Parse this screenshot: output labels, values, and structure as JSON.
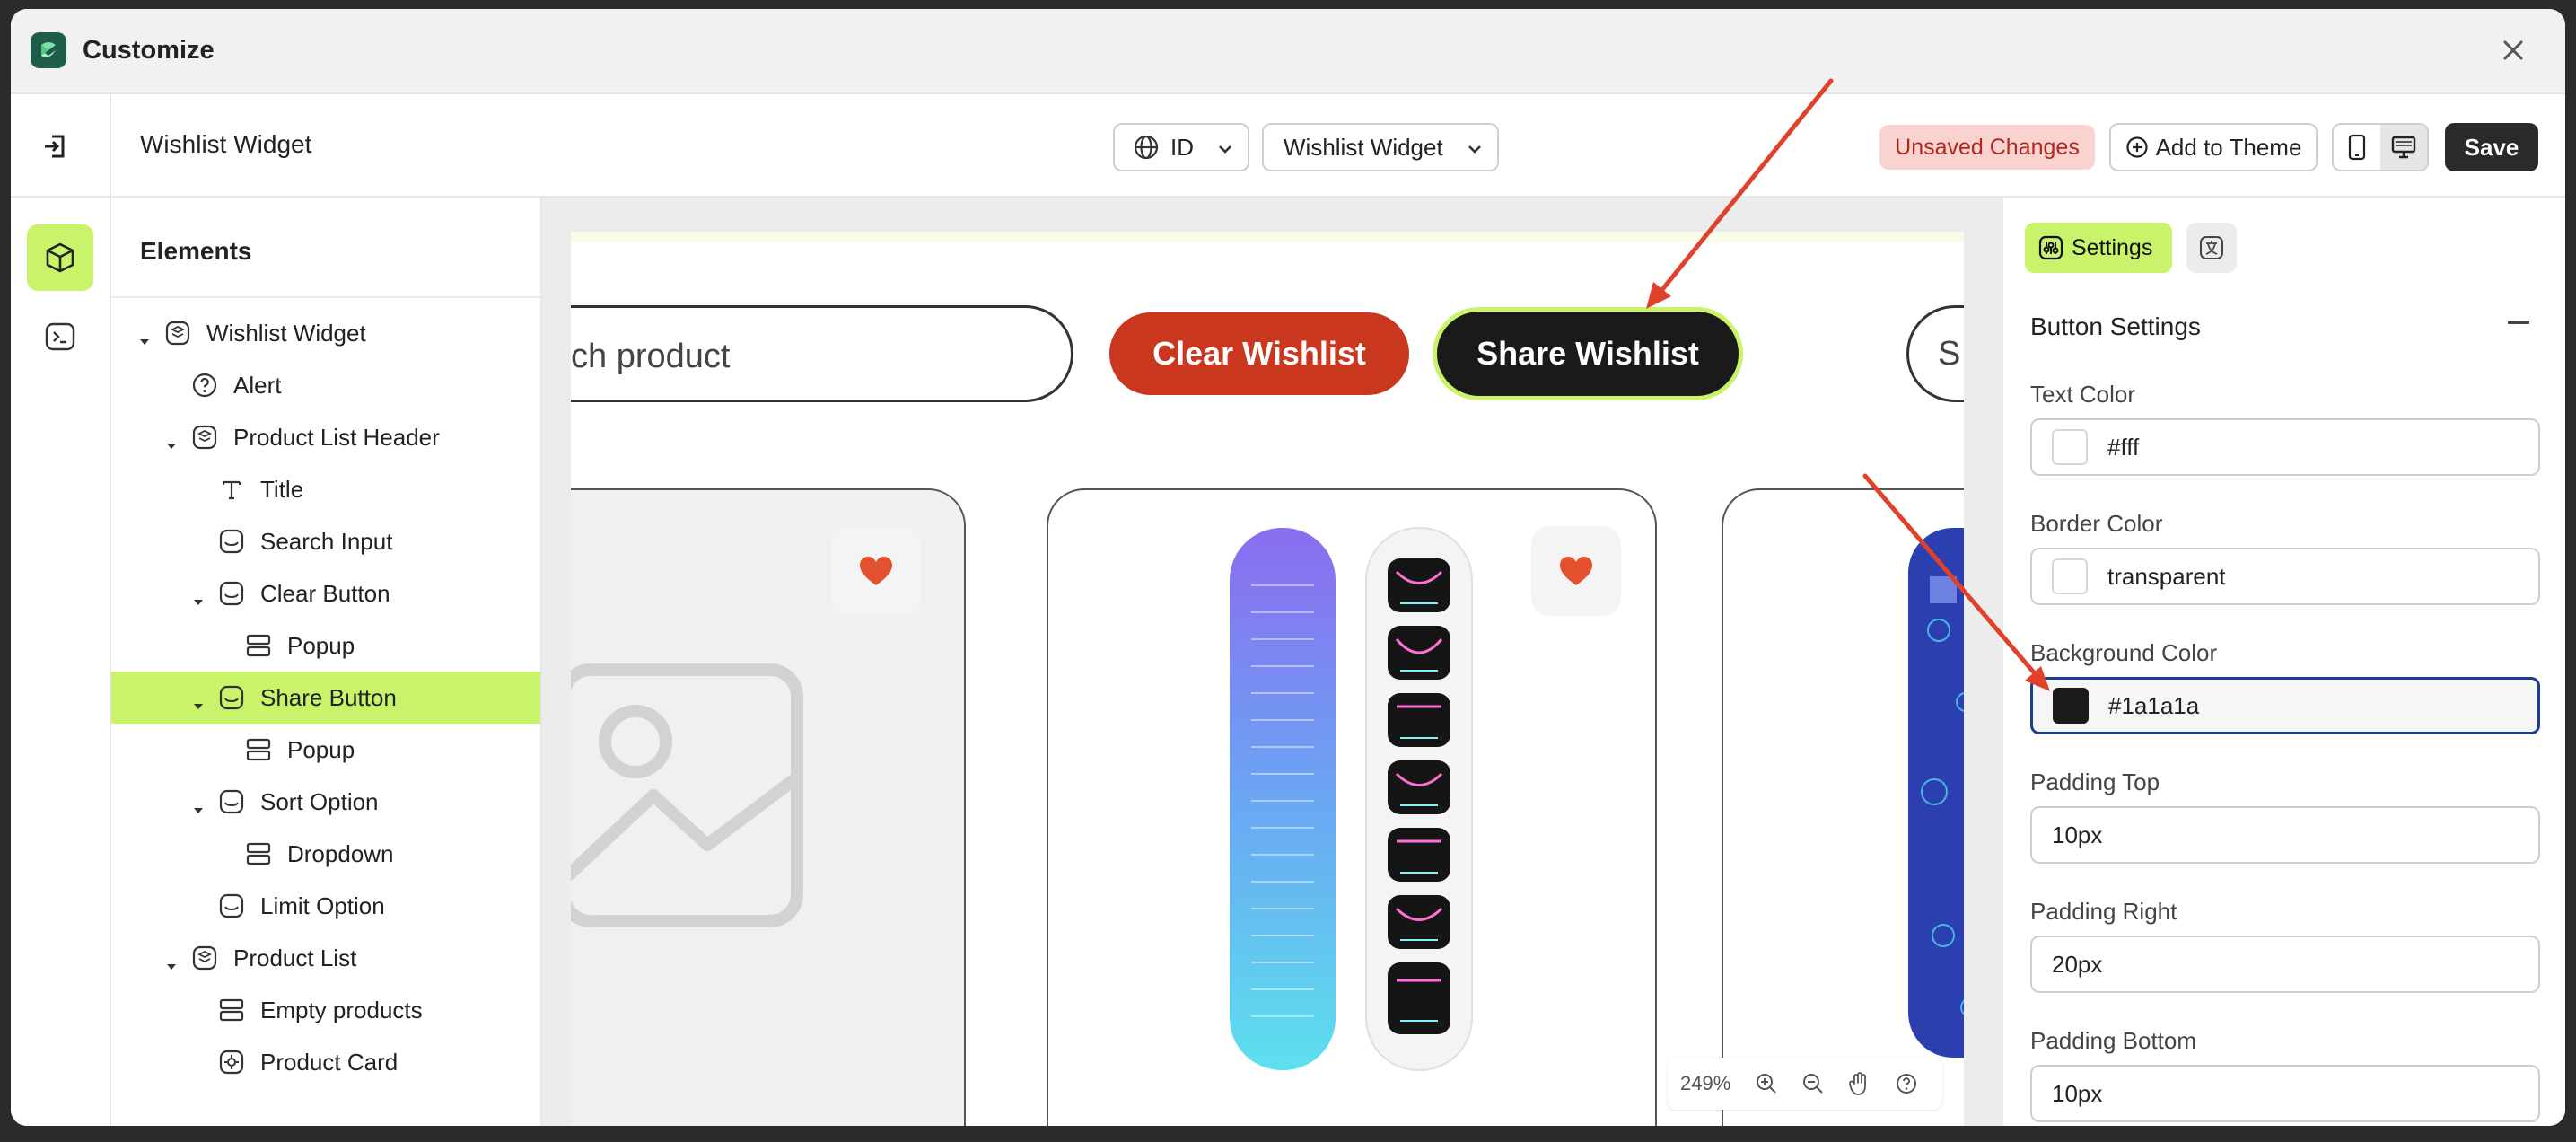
{
  "window": {
    "title": "Customize"
  },
  "toolbar": {
    "page_name": "Wishlist Widget",
    "language": "ID",
    "widget_select": "Wishlist Widget",
    "unsaved_label": "Unsaved Changes",
    "add_theme_label": "Add to Theme",
    "save_label": "Save"
  },
  "elements_panel": {
    "title": "Elements",
    "tree": [
      {
        "label": "Wishlist Widget",
        "depth": 0,
        "caret": true,
        "icon": "widget-icon"
      },
      {
        "label": "Alert",
        "depth": 1,
        "caret": false,
        "icon": "help-circle-icon"
      },
      {
        "label": "Product List Header",
        "depth": 1,
        "caret": true,
        "icon": "widget-icon"
      },
      {
        "label": "Title",
        "depth": 2,
        "caret": false,
        "icon": "text-icon"
      },
      {
        "label": "Search Input",
        "depth": 2,
        "caret": false,
        "icon": "block-icon"
      },
      {
        "label": "Clear Button",
        "depth": 2,
        "caret": true,
        "icon": "block-icon"
      },
      {
        "label": "Popup",
        "depth": 3,
        "caret": false,
        "icon": "layout-rows-icon"
      },
      {
        "label": "Share Button",
        "depth": 2,
        "caret": true,
        "icon": "block-icon",
        "selected": true
      },
      {
        "label": "Popup",
        "depth": 3,
        "caret": false,
        "icon": "layout-rows-icon"
      },
      {
        "label": "Sort Option",
        "depth": 2,
        "caret": true,
        "icon": "block-icon"
      },
      {
        "label": "Dropdown",
        "depth": 3,
        "caret": false,
        "icon": "layout-rows-icon"
      },
      {
        "label": "Limit Option",
        "depth": 2,
        "caret": false,
        "icon": "block-icon"
      },
      {
        "label": "Product List",
        "depth": 1,
        "caret": true,
        "icon": "widget-icon"
      },
      {
        "label": "Empty products",
        "depth": 2,
        "caret": false,
        "icon": "layout-rows-icon"
      },
      {
        "label": "Product Card",
        "depth": 2,
        "caret": false,
        "icon": "gear-box-icon"
      }
    ]
  },
  "preview": {
    "search_placeholder": "ch product",
    "clear_button": "Clear Wishlist",
    "share_button": "Share Wishlist",
    "sort_partial": "S",
    "zoom_level": "249%"
  },
  "settings_panel": {
    "tab_label": "Settings",
    "section_title": "Button Settings",
    "fields": [
      {
        "label": "Text Color",
        "value": "#fff",
        "swatch": "#ffffff",
        "type": "color"
      },
      {
        "label": "Border Color",
        "value": "transparent",
        "swatch": "#ffffff",
        "type": "color"
      },
      {
        "label": "Background Color",
        "value": "#1a1a1a",
        "swatch": "#1a1a1a",
        "type": "color",
        "focused": true
      },
      {
        "label": "Padding Top",
        "value": "10px",
        "type": "text"
      },
      {
        "label": "Padding Right",
        "value": "20px",
        "type": "text"
      },
      {
        "label": "Padding Bottom",
        "value": "10px",
        "type": "text"
      }
    ]
  },
  "colors": {
    "accent": "#c8f36a",
    "clear_button_bg": "#c9371f",
    "share_button_bg": "#1a1a1a",
    "unsaved_bg": "#f9d3d0",
    "unsaved_text": "#b3261e",
    "annotation_arrow": "#e0412a"
  }
}
